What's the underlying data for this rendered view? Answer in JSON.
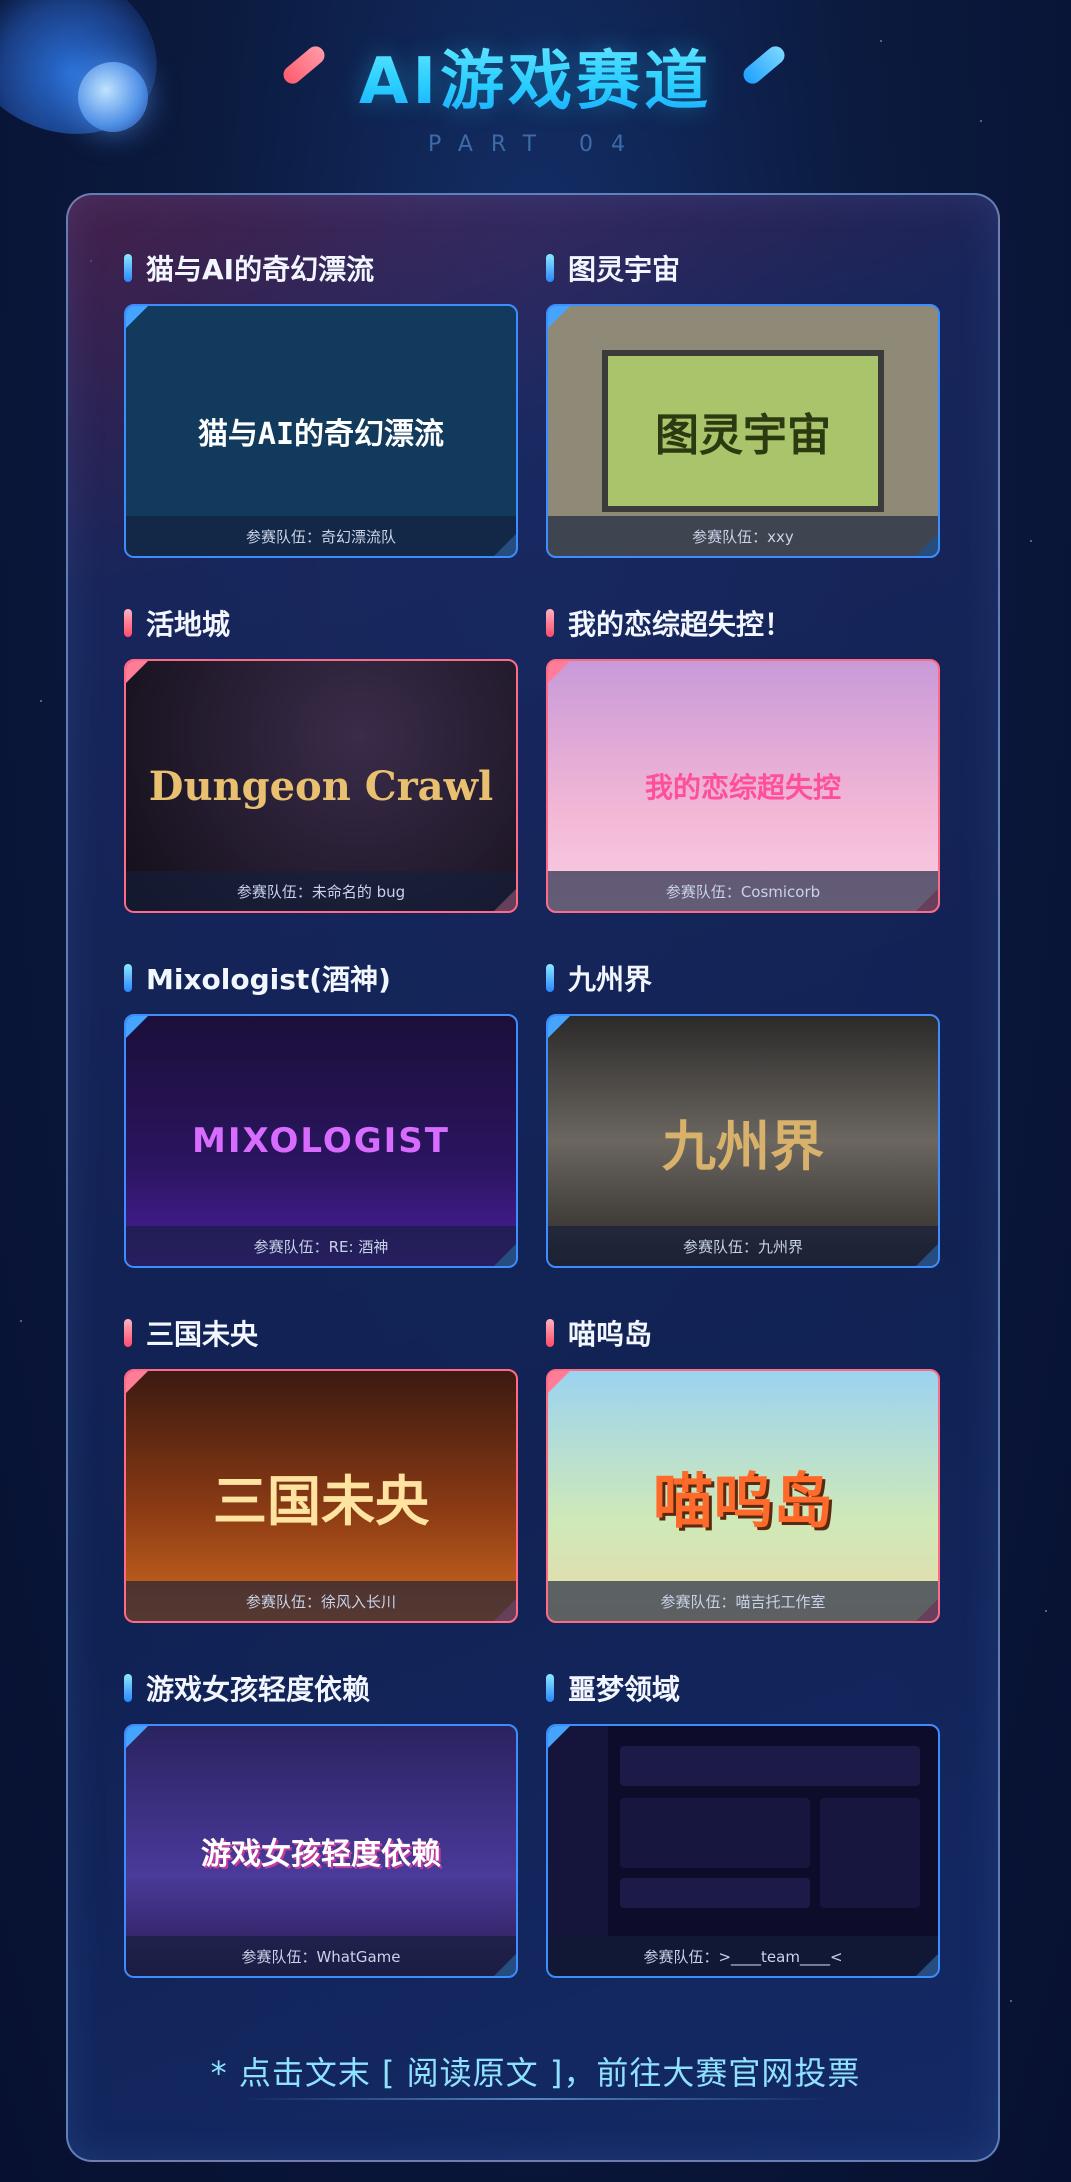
{
  "header": {
    "title": "AI游戏赛道",
    "part": "PART 04"
  },
  "games": [
    {
      "name": "猫与AI的奇幻漂流",
      "team": "参赛队伍：奇幻漂流队",
      "accent": "blue",
      "art_text": "猫与AI的奇幻漂流",
      "art_bg": "#123a5c",
      "art_color": "#ffffff"
    },
    {
      "name": "图灵宇宙",
      "team": "参赛队伍：xxy",
      "accent": "blue",
      "art_text": "图灵宇宙",
      "art_bg": "#8f8a78",
      "art_color": "#2b3a10"
    },
    {
      "name": "活地城",
      "team": "参赛队伍：未命名的 bug",
      "accent": "red",
      "art_text": "Dungeon Crawl",
      "art_bg": "#1a1620",
      "art_color": "#e8c070"
    },
    {
      "name": "我的恋综超失控！",
      "team": "参赛队伍：Cosmicorb",
      "accent": "red",
      "art_text": "我的恋综超失控",
      "art_bg": "#f3b7d6",
      "art_color": "#ff4f9a"
    },
    {
      "name": "Mixologist(酒神)",
      "team": "参赛队伍：RE: 酒神",
      "accent": "blue",
      "art_text": "MIXOLOGIST",
      "art_bg": "#1b0f3a",
      "art_color": "#d86cff"
    },
    {
      "name": "九州界",
      "team": "参赛队伍：九州界",
      "accent": "blue",
      "art_text": "九州界",
      "art_bg": "#4a4640",
      "art_color": "#d8b26a"
    },
    {
      "name": "三国未央",
      "team": "参赛队伍：徐风入长川",
      "accent": "red",
      "art_text": "三国未央",
      "art_bg": "#6b2a12",
      "art_color": "#ffe3a0"
    },
    {
      "name": "喵呜岛",
      "team": "参赛队伍：喵吉托工作室",
      "accent": "red",
      "art_text": "喵呜岛",
      "art_bg": "#9bd3f0",
      "art_color": "#ff6a2a"
    },
    {
      "name": "游戏女孩轻度依赖",
      "team": "参赛队伍：WhatGame",
      "accent": "blue",
      "art_text": "游戏女孩轻度依赖",
      "art_bg": "#2a2360",
      "art_color": "#ffffff"
    },
    {
      "name": "噩梦领域",
      "team": "参赛队伍：>____team____<",
      "accent": "blue",
      "art_text": "",
      "art_bg": "#0d0c2a",
      "art_color": "#ffffff"
    }
  ],
  "footer": {
    "text": "* 点击文末 [ 阅读原文 ]，前往大赛官网投票"
  },
  "colors": {
    "accent_blue": "#3d8dff",
    "accent_red": "#ff6a86",
    "title_cyan": "#2ad0ff"
  }
}
